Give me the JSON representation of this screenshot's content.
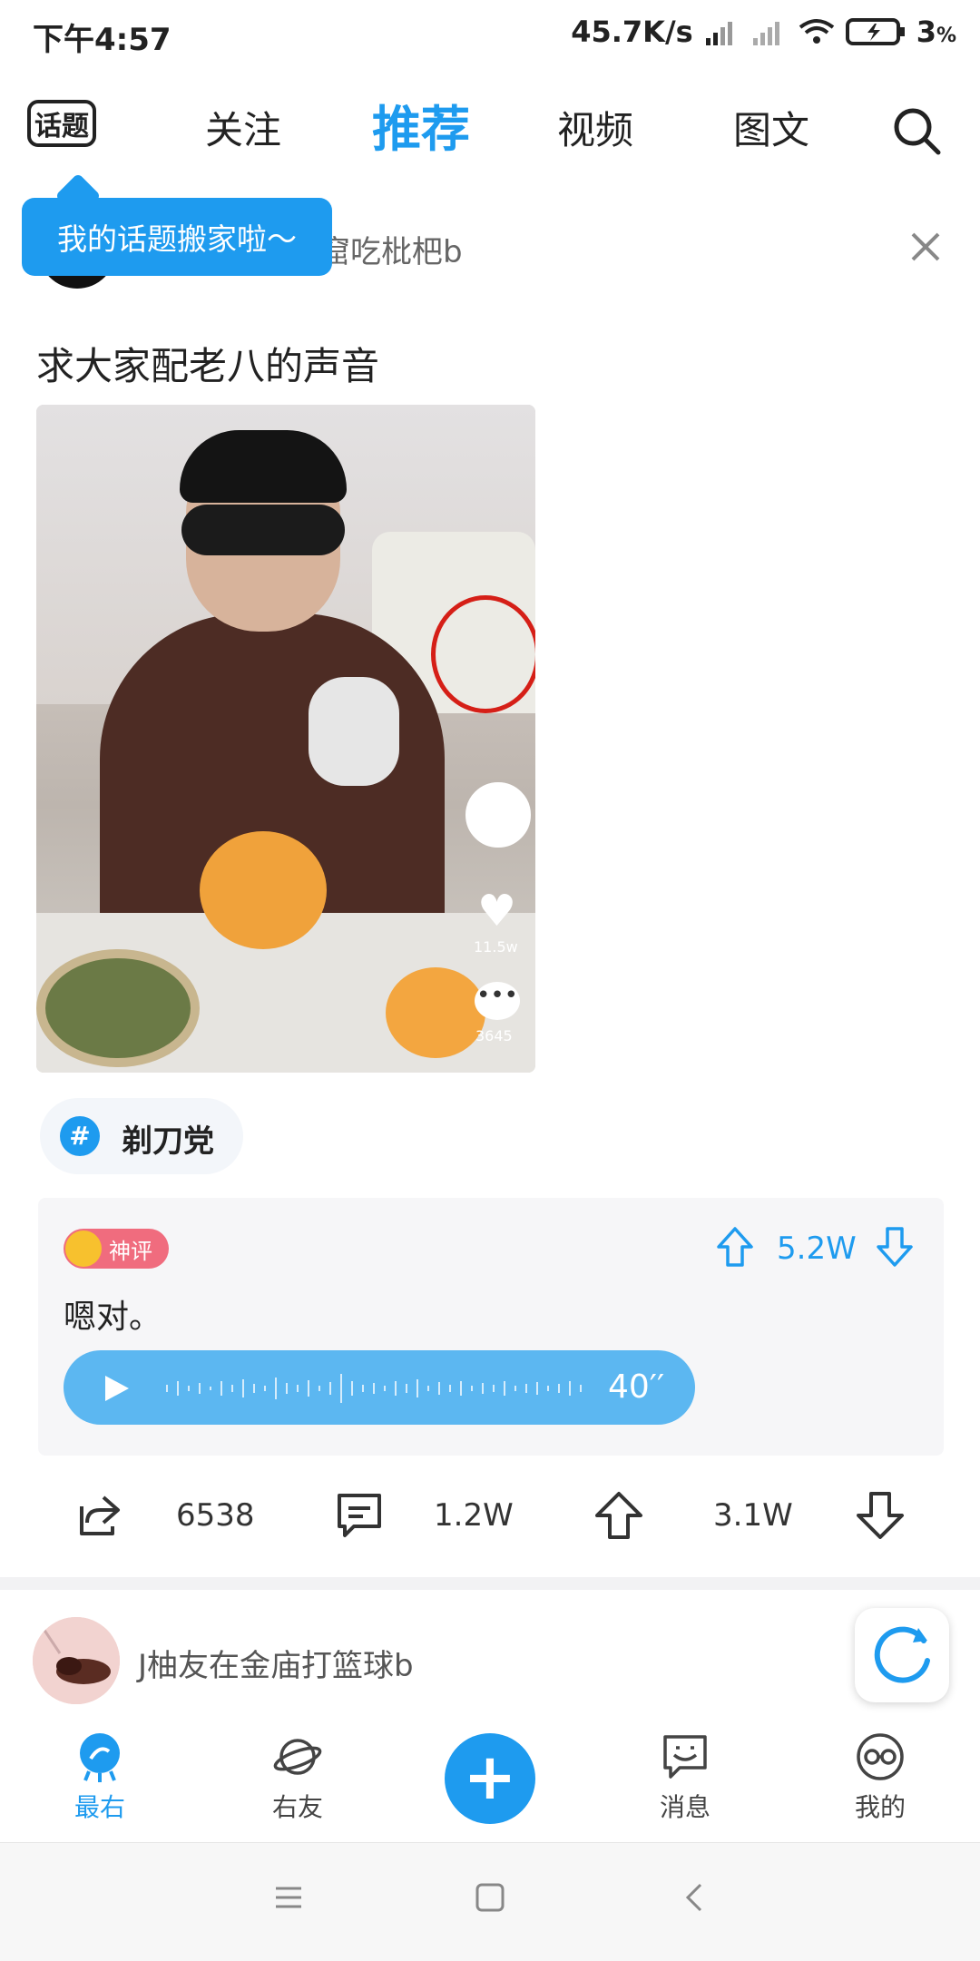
{
  "status": {
    "time": "下午4:57",
    "net_speed": "45.7K/s",
    "battery": "3",
    "battery_unit": "%"
  },
  "top_nav": {
    "topic_button": "话题",
    "tabs": [
      {
        "label": "关注",
        "active": false
      },
      {
        "label": "推荐",
        "active": true
      },
      {
        "label": "视频",
        "active": false
      },
      {
        "label": "图文",
        "active": false
      }
    ]
  },
  "tooltip": {
    "text": "我的话题搬家啦～"
  },
  "post": {
    "username_visible": "窟吃枇杷b",
    "title": "求大家配老八的声音",
    "video": {
      "likes": "11.5w",
      "comments": "3645"
    },
    "tag": {
      "hash": "#",
      "label": "剃刀党"
    },
    "comment": {
      "badge": "神评",
      "score": "5.2W",
      "text": "嗯对。",
      "voice_duration": "40′′"
    },
    "actions": {
      "share": "6538",
      "comments": "1.2W",
      "upvotes": "3.1W"
    }
  },
  "next_post": {
    "username": "J柚友在金庙打篮球b"
  },
  "bottom_tabs": [
    {
      "label": "最右",
      "active": true
    },
    {
      "label": "右友",
      "active": false
    },
    {
      "label": "消息",
      "active": false
    },
    {
      "label": "我的",
      "active": false
    }
  ],
  "colors": {
    "accent": "#1e9bef",
    "badge_pink": "#f06c7e"
  }
}
